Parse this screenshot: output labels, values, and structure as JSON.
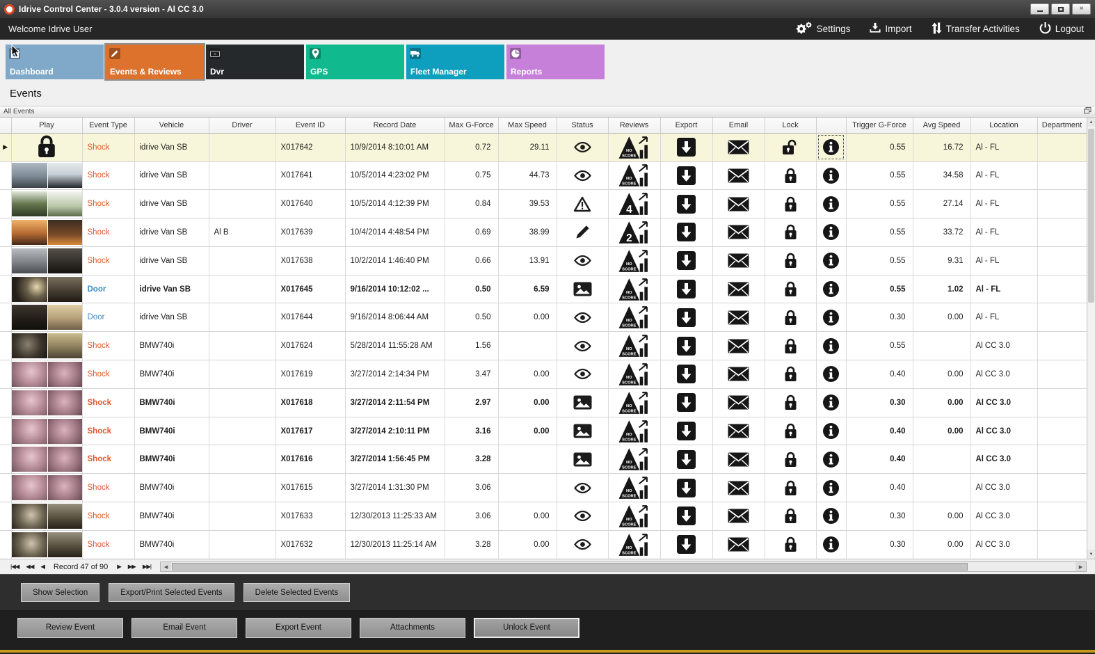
{
  "window": {
    "title": "Idrive Control Center - 3.0.4 version - Al CC 3.0"
  },
  "topbar": {
    "welcome": "Welcome Idrive User",
    "actions": [
      {
        "id": "settings",
        "label": "Settings"
      },
      {
        "id": "import",
        "label": "Import"
      },
      {
        "id": "transfer",
        "label": "Transfer Activities"
      },
      {
        "id": "logout",
        "label": "Logout"
      }
    ]
  },
  "nav_tabs": [
    {
      "id": "dashboard",
      "label": "Dashboard",
      "color": "#7fa8c9",
      "active": false
    },
    {
      "id": "events",
      "label": "Events & Reviews",
      "color": "#dd722c",
      "active": true
    },
    {
      "id": "dvr",
      "label": "Dvr",
      "color": "#26292b",
      "active": false
    },
    {
      "id": "gps",
      "label": "GPS",
      "color": "#10b98e",
      "active": false
    },
    {
      "id": "fleet",
      "label": "Fleet Manager",
      "color": "#0f9fbe",
      "active": false
    },
    {
      "id": "reports",
      "label": "Reports",
      "color": "#c780da",
      "active": false
    }
  ],
  "page": {
    "title": "Events",
    "group_header": "All Events"
  },
  "table": {
    "columns": [
      "",
      "Play",
      "Event Type",
      "Vehicle",
      "Driver",
      "Event ID",
      "Record Date",
      "Max G-Force",
      "Max Speed",
      "Status",
      "Reviews",
      "Export",
      "Email",
      "Lock",
      "",
      "Trigger G-Force",
      "Avg Speed",
      "Location",
      "Department"
    ],
    "rows": [
      {
        "play": "lock",
        "event_type": "Shock",
        "type_style": "shock",
        "vehicle": "idrive Van SB",
        "driver": "",
        "event_id": "X017642",
        "record_date": "10/9/2014 8:10:01 AM",
        "max_g": "0.72",
        "max_speed": "29.11",
        "status": "eye",
        "review": "NO SCORE",
        "lock": "open",
        "trigger_g": "0.55",
        "avg_speed": "16.72",
        "location": "Al - FL",
        "bold": false,
        "selected": true
      },
      {
        "play": "t1",
        "event_type": "Shock",
        "type_style": "shock",
        "vehicle": "idrive Van SB",
        "driver": "",
        "event_id": "X017641",
        "record_date": "10/5/2014 4:23:02 PM",
        "max_g": "0.75",
        "max_speed": "44.73",
        "status": "eye",
        "review": "NO SCORE",
        "lock": "closed",
        "trigger_g": "0.55",
        "avg_speed": "34.58",
        "location": "Al - FL",
        "bold": false,
        "selected": false
      },
      {
        "play": "t2",
        "event_type": "Shock",
        "type_style": "shock",
        "vehicle": "idrive Van SB",
        "driver": "",
        "event_id": "X017640",
        "record_date": "10/5/2014 4:12:39 PM",
        "max_g": "0.84",
        "max_speed": "39.53",
        "status": "warning",
        "review": "4",
        "lock": "closed",
        "trigger_g": "0.55",
        "avg_speed": "27.14",
        "location": "Al - FL",
        "bold": false,
        "selected": false
      },
      {
        "play": "t3",
        "event_type": "Shock",
        "type_style": "shock",
        "vehicle": "idrive Van SB",
        "driver": "Al B",
        "event_id": "X017639",
        "record_date": "10/4/2014 4:48:54 PM",
        "max_g": "0.69",
        "max_speed": "38.99",
        "status": "pencil",
        "review": "2",
        "lock": "closed",
        "trigger_g": "0.55",
        "avg_speed": "33.72",
        "location": "Al - FL",
        "bold": false,
        "selected": false
      },
      {
        "play": "t4",
        "event_type": "Shock",
        "type_style": "shock",
        "vehicle": "idrive Van SB",
        "driver": "",
        "event_id": "X017638",
        "record_date": "10/2/2014 1:46:40 PM",
        "max_g": "0.66",
        "max_speed": "13.91",
        "status": "eye",
        "review": "NO SCORE",
        "lock": "closed",
        "trigger_g": "0.55",
        "avg_speed": "9.31",
        "location": "Al - FL",
        "bold": false,
        "selected": false
      },
      {
        "play": "t5",
        "event_type": "Door",
        "type_style": "door",
        "vehicle": "idrive Van SB",
        "driver": "",
        "event_id": "X017645",
        "record_date": "9/16/2014 10:12:02 ...",
        "max_g": "0.50",
        "max_speed": "6.59",
        "status": "image",
        "review": "NO SCORE",
        "lock": "closed",
        "trigger_g": "0.55",
        "avg_speed": "1.02",
        "location": "Al - FL",
        "bold": true,
        "selected": false
      },
      {
        "play": "t6",
        "event_type": "Door",
        "type_style": "door",
        "vehicle": "idrive Van SB",
        "driver": "",
        "event_id": "X017644",
        "record_date": "9/16/2014 8:06:44 AM",
        "max_g": "0.50",
        "max_speed": "0.00",
        "status": "eye",
        "review": "NO SCORE",
        "lock": "closed",
        "trigger_g": "0.30",
        "avg_speed": "0.00",
        "location": "Al - FL",
        "bold": false,
        "selected": false
      },
      {
        "play": "t7",
        "event_type": "Shock",
        "type_style": "shock",
        "vehicle": "BMW740i",
        "driver": "",
        "event_id": "X017624",
        "record_date": "5/28/2014 11:55:28 AM",
        "max_g": "1.56",
        "max_speed": "",
        "status": "eye",
        "review": "NO SCORE",
        "lock": "closed",
        "trigger_g": "0.55",
        "avg_speed": "",
        "location": "Al CC 3.0",
        "bold": false,
        "selected": false
      },
      {
        "play": "t8",
        "event_type": "Shock",
        "type_style": "shock",
        "vehicle": "BMW740i",
        "driver": "",
        "event_id": "X017619",
        "record_date": "3/27/2014 2:14:34 PM",
        "max_g": "3.47",
        "max_speed": "0.00",
        "status": "eye",
        "review": "NO SCORE",
        "lock": "closed",
        "trigger_g": "0.40",
        "avg_speed": "0.00",
        "location": "Al CC 3.0",
        "bold": false,
        "selected": false
      },
      {
        "play": "t8",
        "event_type": "Shock",
        "type_style": "shock",
        "vehicle": "BMW740i",
        "driver": "",
        "event_id": "X017618",
        "record_date": "3/27/2014 2:11:54 PM",
        "max_g": "2.97",
        "max_speed": "0.00",
        "status": "image",
        "review": "NO SCORE",
        "lock": "closed",
        "trigger_g": "0.30",
        "avg_speed": "0.00",
        "location": "Al CC 3.0",
        "bold": true,
        "selected": false
      },
      {
        "play": "t8",
        "event_type": "Shock",
        "type_style": "shock",
        "vehicle": "BMW740i",
        "driver": "",
        "event_id": "X017617",
        "record_date": "3/27/2014 2:10:11 PM",
        "max_g": "3.16",
        "max_speed": "0.00",
        "status": "image",
        "review": "NO SCORE",
        "lock": "closed",
        "trigger_g": "0.40",
        "avg_speed": "0.00",
        "location": "Al CC 3.0",
        "bold": true,
        "selected": false
      },
      {
        "play": "t8",
        "event_type": "Shock",
        "type_style": "shock",
        "vehicle": "BMW740i",
        "driver": "",
        "event_id": "X017616",
        "record_date": "3/27/2014 1:56:45 PM",
        "max_g": "3.28",
        "max_speed": "",
        "status": "image",
        "review": "NO SCORE",
        "lock": "closed",
        "trigger_g": "0.40",
        "avg_speed": "",
        "location": "Al CC 3.0",
        "bold": true,
        "selected": false
      },
      {
        "play": "t8",
        "event_type": "Shock",
        "type_style": "shock",
        "vehicle": "BMW740i",
        "driver": "",
        "event_id": "X017615",
        "record_date": "3/27/2014 1:31:30 PM",
        "max_g": "3.06",
        "max_speed": "",
        "status": "eye",
        "review": "NO SCORE",
        "lock": "closed",
        "trigger_g": "0.40",
        "avg_speed": "",
        "location": "Al CC 3.0",
        "bold": false,
        "selected": false
      },
      {
        "play": "t9",
        "event_type": "Shock",
        "type_style": "shock",
        "vehicle": "BMW740i",
        "driver": "",
        "event_id": "X017633",
        "record_date": "12/30/2013 11:25:33 AM",
        "max_g": "3.06",
        "max_speed": "0.00",
        "status": "eye",
        "review": "NO SCORE",
        "lock": "closed",
        "trigger_g": "0.30",
        "avg_speed": "0.00",
        "location": "Al CC 3.0",
        "bold": false,
        "selected": false
      },
      {
        "play": "t9",
        "event_type": "Shock",
        "type_style": "shock",
        "vehicle": "BMW740i",
        "driver": "",
        "event_id": "X017632",
        "record_date": "12/30/2013 11:25:14 AM",
        "max_g": "3.28",
        "max_speed": "0.00",
        "status": "eye",
        "review": "NO SCORE",
        "lock": "closed",
        "trigger_g": "0.30",
        "avg_speed": "0.00",
        "location": "Al CC 3.0",
        "bold": false,
        "selected": false
      }
    ]
  },
  "record_nav": {
    "label": "Record 47 of 90"
  },
  "selection_buttons": [
    "Show Selection",
    "Export/Print Selected Events",
    "Delete Selected  Events"
  ],
  "action_buttons": [
    {
      "label": "Review Event",
      "focused": false
    },
    {
      "label": "Email Event",
      "focused": false
    },
    {
      "label": "Export Event",
      "focused": false
    },
    {
      "label": "Attachments",
      "focused": false
    },
    {
      "label": "Unlock Event",
      "focused": true
    }
  ],
  "colors": {
    "accent_orange": "#dd722c",
    "shock_text": "#e05a2e",
    "door_text": "#3e8bcb",
    "selected_row": "#f8f6da",
    "footer_gold": "#c8991d"
  }
}
